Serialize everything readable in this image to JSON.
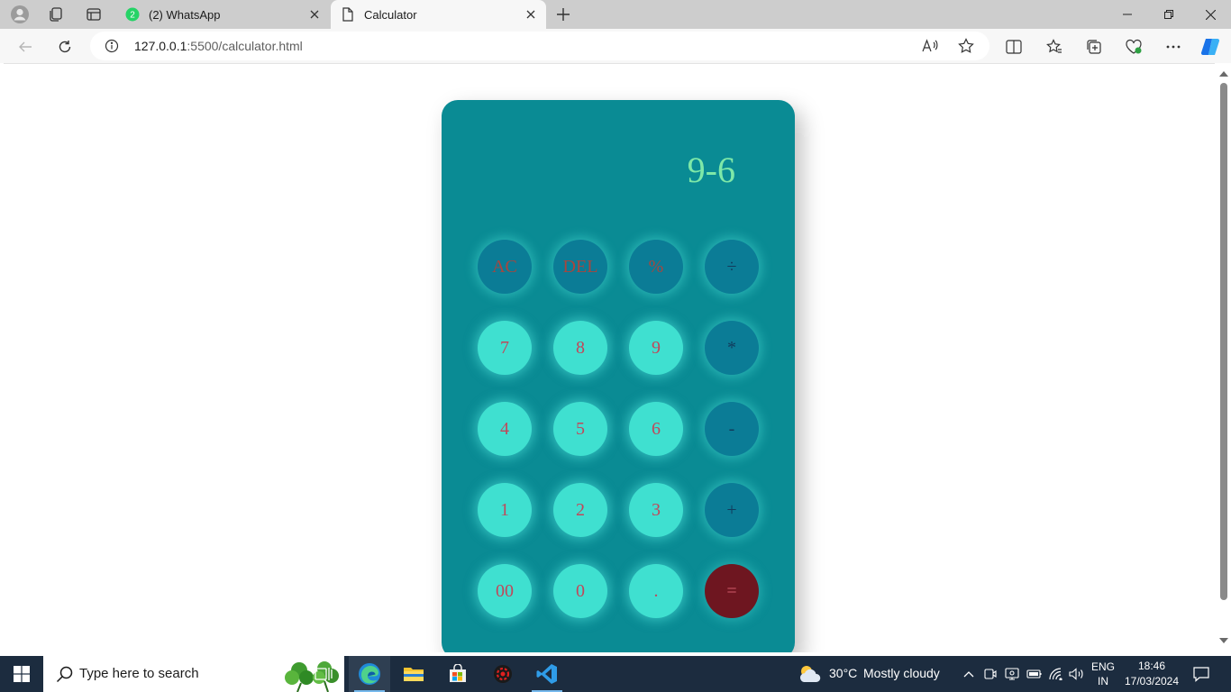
{
  "browser": {
    "tabs": [
      {
        "title": "(2) WhatsApp",
        "badge": "2",
        "active": false
      },
      {
        "title": "Calculator",
        "active": true
      }
    ],
    "address": {
      "host": "127.0.0.1",
      "path": ":5500/calculator.html"
    }
  },
  "calculator": {
    "display": "9-6",
    "rows": [
      [
        {
          "label": "AC",
          "kind": "fn"
        },
        {
          "label": "DEL",
          "kind": "fn"
        },
        {
          "label": "%",
          "kind": "fn"
        },
        {
          "label": "÷",
          "kind": "op"
        }
      ],
      [
        {
          "label": "7",
          "kind": "num"
        },
        {
          "label": "8",
          "kind": "num"
        },
        {
          "label": "9",
          "kind": "num"
        },
        {
          "label": "*",
          "kind": "op"
        }
      ],
      [
        {
          "label": "4",
          "kind": "num"
        },
        {
          "label": "5",
          "kind": "num"
        },
        {
          "label": "6",
          "kind": "num"
        },
        {
          "label": "-",
          "kind": "op"
        }
      ],
      [
        {
          "label": "1",
          "kind": "num"
        },
        {
          "label": "2",
          "kind": "num"
        },
        {
          "label": "3",
          "kind": "num"
        },
        {
          "label": "+",
          "kind": "op"
        }
      ],
      [
        {
          "label": "00",
          "kind": "num"
        },
        {
          "label": "0",
          "kind": "num"
        },
        {
          "label": ".",
          "kind": "num"
        },
        {
          "label": "=",
          "kind": "eq"
        }
      ]
    ],
    "colors": {
      "body": "#0a8b94",
      "number_key": "#3fe0d0",
      "function_key": "#0b7c96",
      "equals_key": "#6e1620",
      "display_text": "#7ee8a8"
    }
  },
  "taskbar": {
    "search_placeholder": "Type here to search",
    "apps": [
      "task-view",
      "edge",
      "file-explorer",
      "microsoft-store",
      "settings-gear",
      "vscode"
    ],
    "weather": {
      "temp": "30°C",
      "condition": "Mostly cloudy"
    },
    "language": {
      "lang": "ENG",
      "region": "IN"
    },
    "clock": {
      "time": "18:46",
      "date": "17/03/2024"
    }
  }
}
